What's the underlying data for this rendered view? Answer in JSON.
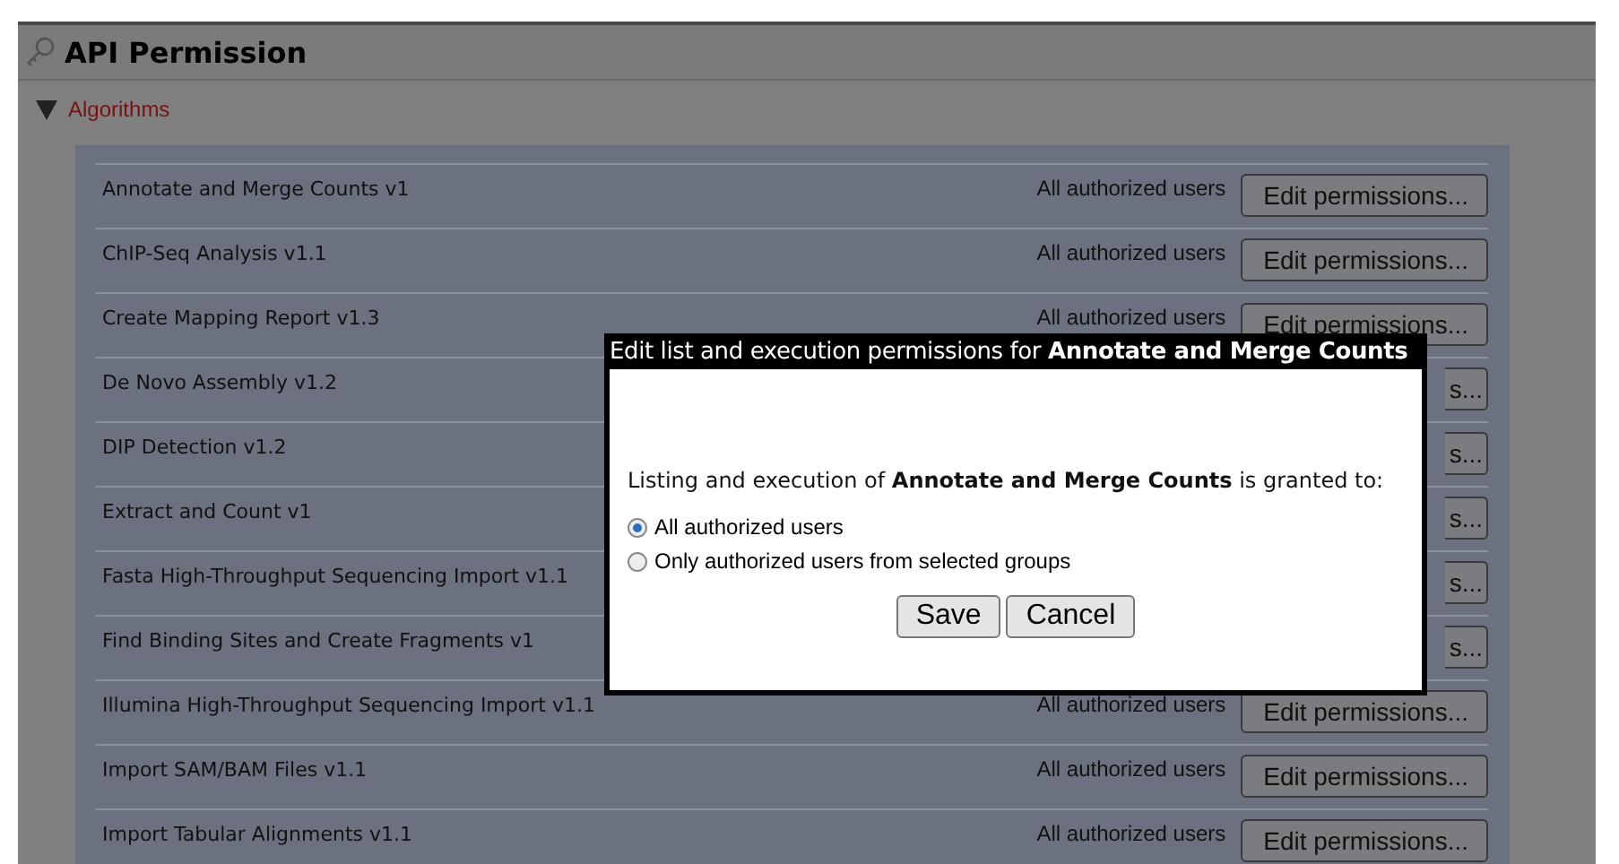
{
  "header": {
    "title": "API Permission"
  },
  "section": {
    "label": "Algorithms",
    "expanded": true
  },
  "rows": [
    {
      "name": "Annotate and Merge Counts v1",
      "access": "All authorized users",
      "button": "Edit permissions..."
    },
    {
      "name": "ChIP-Seq Analysis v1.1",
      "access": "All authorized users",
      "button": "Edit permissions..."
    },
    {
      "name": "Create Mapping Report v1.3",
      "access": "All authorized users",
      "button": "Edit permissions..."
    },
    {
      "name": "De Novo Assembly v1.2",
      "button": "s..."
    },
    {
      "name": "DIP Detection v1.2",
      "button": "s..."
    },
    {
      "name": "Extract and Count v1",
      "button": "s..."
    },
    {
      "name": "Fasta High-Throughput Sequencing Import v1.1",
      "button": "s..."
    },
    {
      "name": "Find Binding Sites and Create Fragments v1",
      "button": "s..."
    },
    {
      "name": "Illumina High-Throughput Sequencing Import v1.1",
      "access": "All authorized users",
      "button": "Edit permissions..."
    },
    {
      "name": "Import SAM/BAM Files v1.1",
      "access": "All authorized users",
      "button": "Edit permissions..."
    },
    {
      "name": "Import Tabular Alignments v1.1",
      "access": "All authorized users",
      "button": "Edit permissions..."
    }
  ],
  "dialog": {
    "title": "Edit list and execution permissions for **Annotate and Merge Counts**",
    "message": "Listing and execution of **Annotate and Merge Counts** is granted to:",
    "options": [
      {
        "label": "All authorized users",
        "selected": true
      },
      {
        "label": "Only authorized users from selected groups",
        "selected": false
      }
    ],
    "buttons": [
      "Save",
      "Cancel"
    ]
  }
}
